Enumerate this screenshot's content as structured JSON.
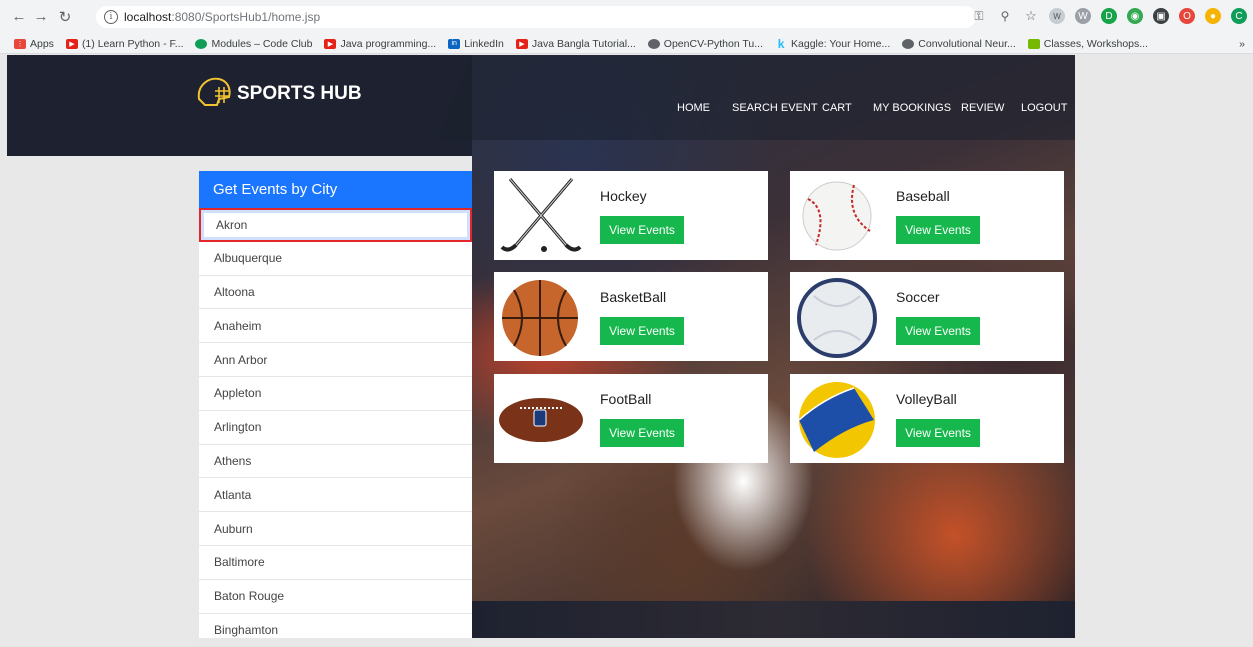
{
  "browser": {
    "url_host": "localhost",
    "url_port_path": ":8080/SportsHub1/home.jsp",
    "bookmarks": [
      {
        "label": "Apps",
        "color": "#e8453c"
      },
      {
        "label": "(1) Learn Python - F...",
        "color": "#e62117"
      },
      {
        "label": "Modules – Code Club",
        "color": "#0f9d58"
      },
      {
        "label": "Java programming...",
        "color": "#e62117"
      },
      {
        "label": "LinkedIn",
        "color": "#0a66c2"
      },
      {
        "label": "Java Bangla Tutorial...",
        "color": "#e62117"
      },
      {
        "label": "OpenCV-Python Tu...",
        "color": "#5f6368"
      },
      {
        "label": "Kaggle: Your Home...",
        "color": "#20beff"
      },
      {
        "label": "Convolutional Neur...",
        "color": "#5f6368"
      },
      {
        "label": "Classes, Workshops...",
        "color": "#76b900"
      }
    ],
    "more": "»"
  },
  "site": {
    "logo_text": "SPORTS HUB",
    "nav": [
      "HOME",
      "SEARCH EVENT",
      "CART",
      "MY BOOKINGS",
      "REVIEW",
      "LOGOUT"
    ]
  },
  "sidebar": {
    "title": "Get Events by City",
    "cities": [
      "Akron",
      "Albuquerque",
      "Altoona",
      "Anaheim",
      "Ann Arbor",
      "Appleton",
      "Arlington",
      "Athens",
      "Atlanta",
      "Auburn",
      "Baltimore",
      "Baton Rouge",
      "Binghamton"
    ],
    "selected": "Akron"
  },
  "sports": [
    {
      "name": "Hockey",
      "button": "View Events",
      "icon": "hockey-sticks-icon"
    },
    {
      "name": "Baseball",
      "button": "View Events",
      "icon": "baseball-icon"
    },
    {
      "name": "BasketBall",
      "button": "View Events",
      "icon": "basketball-icon"
    },
    {
      "name": "Soccer",
      "button": "View Events",
      "icon": "soccer-ball-icon"
    },
    {
      "name": "FootBall",
      "button": "View Events",
      "icon": "football-icon"
    },
    {
      "name": "VolleyBall",
      "button": "View Events",
      "icon": "volleyball-icon"
    }
  ],
  "colors": {
    "sidebar_header": "#1a75ff",
    "button": "#16b84d",
    "selected_border": "#e3262a",
    "header_bg": "#1e2230"
  }
}
